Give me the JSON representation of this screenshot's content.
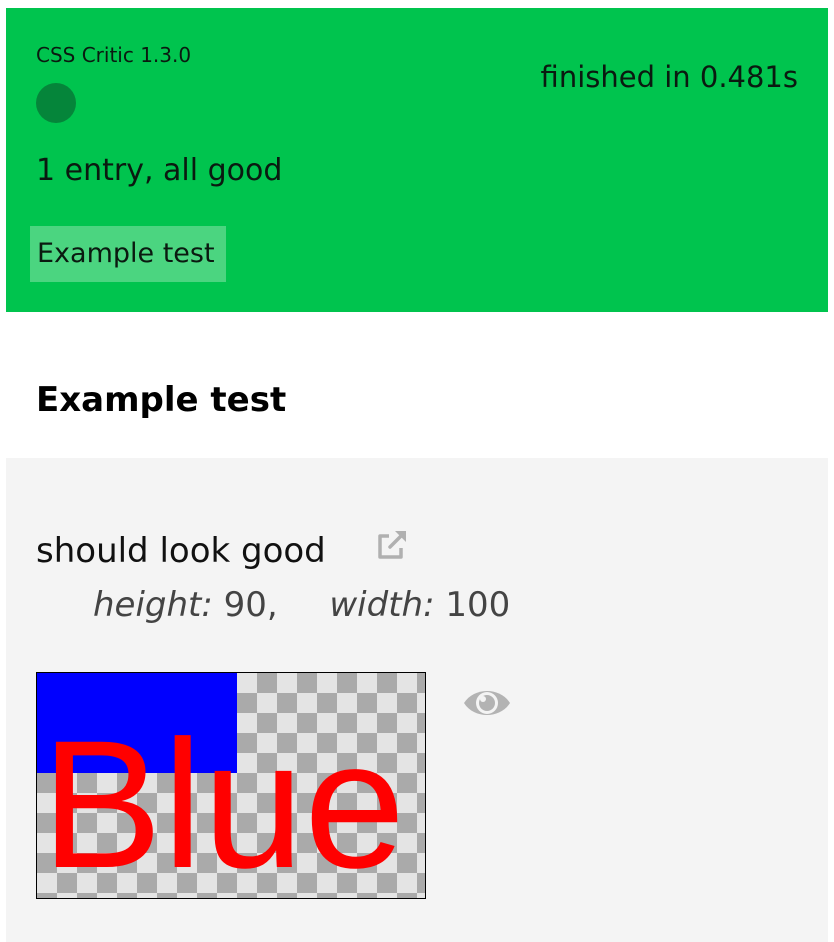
{
  "header": {
    "app_version": "CSS Critic 1.3.0",
    "finished": "finished in 0.481s",
    "summary": "1 entry, all good",
    "test_link": "Example test",
    "status_color": "#00c44e"
  },
  "section": {
    "title": "Example test"
  },
  "entry": {
    "name": "should look good",
    "height_key": "height:",
    "height_value": "90,",
    "width_key": "width:",
    "width_value": "100",
    "preview_text": "Blue",
    "icons": [
      "external-link-icon",
      "eye-icon"
    ]
  }
}
